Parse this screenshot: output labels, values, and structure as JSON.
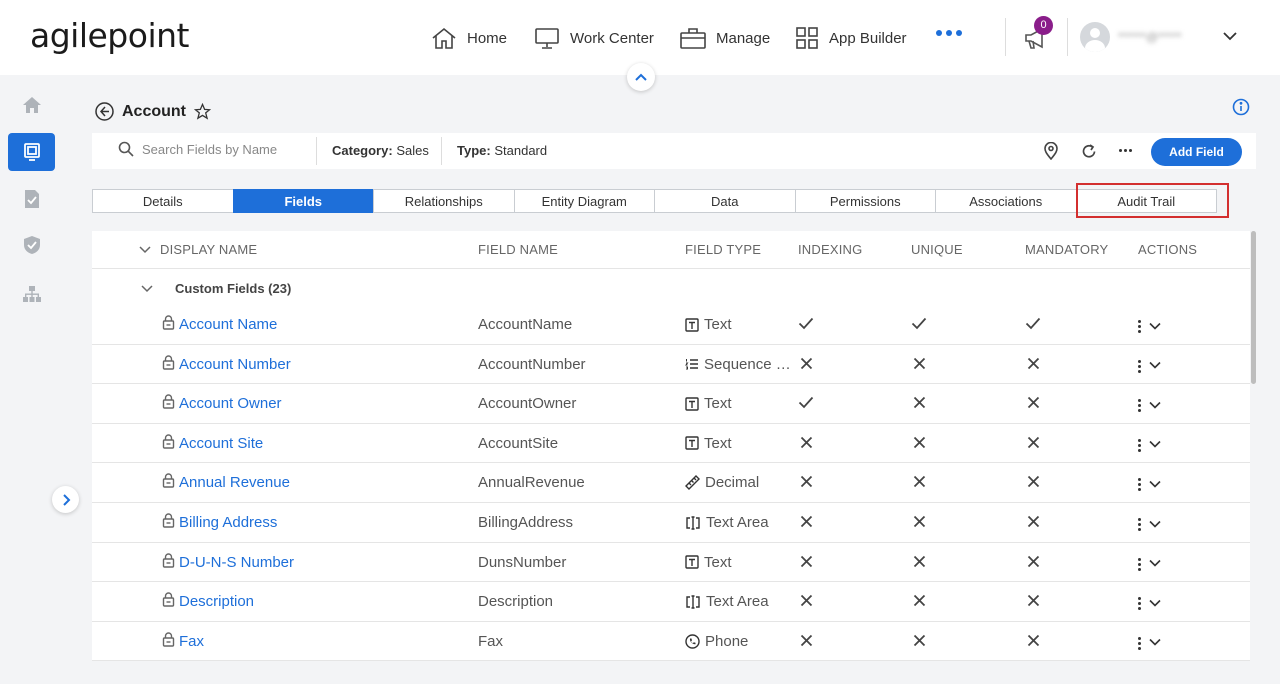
{
  "header": {
    "logo": "agilepoint",
    "nav": [
      {
        "label": "Home",
        "icon": "home-icon"
      },
      {
        "label": "Work Center",
        "icon": "monitor-icon"
      },
      {
        "label": "Manage",
        "icon": "briefcase-icon"
      },
      {
        "label": "App Builder",
        "icon": "grid-icon"
      }
    ],
    "notification_count": "0",
    "username": "******@*****"
  },
  "page": {
    "title": "Account"
  },
  "filters": {
    "search_placeholder": "Search Fields by Name",
    "category_label": "Category:",
    "category_value": "Sales",
    "type_label": "Type:",
    "type_value": "Standard",
    "add_field_label": "Add Field"
  },
  "tabs": [
    {
      "label": "Details",
      "active": false
    },
    {
      "label": "Fields",
      "active": true
    },
    {
      "label": "Relationships",
      "active": false
    },
    {
      "label": "Entity Diagram",
      "active": false
    },
    {
      "label": "Data",
      "active": false
    },
    {
      "label": "Permissions",
      "active": false
    },
    {
      "label": "Associations",
      "active": false
    },
    {
      "label": "Audit Trail",
      "active": false
    }
  ],
  "table": {
    "columns": [
      "DISPLAY NAME",
      "FIELD NAME",
      "FIELD TYPE",
      "INDEXING",
      "UNIQUE",
      "MANDATORY",
      "ACTIONS"
    ],
    "group_label": "Custom Fields (23)",
    "rows": [
      {
        "display_name": "Account Name",
        "field_name": "AccountName",
        "field_type": "Text",
        "type_icon": "text-icon",
        "indexing": true,
        "unique": true,
        "mandatory": true
      },
      {
        "display_name": "Account Number",
        "field_name": "AccountNumber",
        "field_type": "Sequence Number",
        "type_icon": "list-icon",
        "indexing": false,
        "unique": false,
        "mandatory": false
      },
      {
        "display_name": "Account Owner",
        "field_name": "AccountOwner",
        "field_type": "Text",
        "type_icon": "text-icon",
        "indexing": true,
        "unique": false,
        "mandatory": false
      },
      {
        "display_name": "Account Site",
        "field_name": "AccountSite",
        "field_type": "Text",
        "type_icon": "text-icon",
        "indexing": false,
        "unique": false,
        "mandatory": false
      },
      {
        "display_name": "Annual Revenue",
        "field_name": "AnnualRevenue",
        "field_type": "Decimal",
        "type_icon": "ruler-icon",
        "indexing": false,
        "unique": false,
        "mandatory": false
      },
      {
        "display_name": "Billing Address",
        "field_name": "BillingAddress",
        "field_type": "Text Area",
        "type_icon": "textarea-icon",
        "indexing": false,
        "unique": false,
        "mandatory": false
      },
      {
        "display_name": "D-U-N-S Number",
        "field_name": "DunsNumber",
        "field_type": "Text",
        "type_icon": "text-icon",
        "indexing": false,
        "unique": false,
        "mandatory": false
      },
      {
        "display_name": "Description",
        "field_name": "Description",
        "field_type": "Text Area",
        "type_icon": "textarea-icon",
        "indexing": false,
        "unique": false,
        "mandatory": false
      },
      {
        "display_name": "Fax",
        "field_name": "Fax",
        "field_type": "Phone",
        "type_icon": "phone-icon",
        "indexing": false,
        "unique": false,
        "mandatory": false
      }
    ]
  },
  "colors": {
    "accent": "#1e6fd9",
    "badge": "#8a1d8a",
    "highlight": "#d32f2f"
  }
}
